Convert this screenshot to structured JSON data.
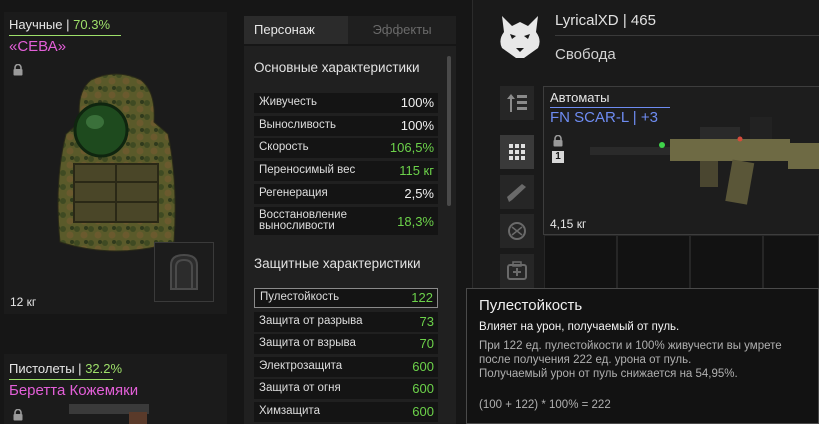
{
  "armor": {
    "category": "Научные",
    "separator": "|",
    "percent": "70.3%",
    "name": "«СЕВА»",
    "weight": "12 кг"
  },
  "pistol": {
    "category": "Пистолеты",
    "separator": "|",
    "percent": "32.2%",
    "name": "Беретта Кожемяки"
  },
  "tabs": {
    "character": "Персонаж",
    "effects": "Эффекты"
  },
  "basic": {
    "title": "Основные характеристики",
    "rows": [
      {
        "label": "Живучесть",
        "value": "100%",
        "tone": "white"
      },
      {
        "label": "Выносливость",
        "value": "100%",
        "tone": "white"
      },
      {
        "label": "Скорость",
        "value": "106,5%",
        "tone": "green"
      },
      {
        "label": "Переносимый вес",
        "value": "115 кг",
        "tone": "green"
      },
      {
        "label": "Регенерация",
        "value": "2,5%",
        "tone": "white"
      },
      {
        "label": "Восстановление выносливости",
        "value": "18,3%",
        "tone": "green"
      }
    ]
  },
  "protect": {
    "title": "Защитные характеристики",
    "rows": [
      {
        "label": "Пулестойкость",
        "value": "122",
        "tone": "green"
      },
      {
        "label": "Защита от разрыва",
        "value": "73",
        "tone": "green"
      },
      {
        "label": "Защита от взрыва",
        "value": "70",
        "tone": "green"
      },
      {
        "label": "Электрозащита",
        "value": "600",
        "tone": "green"
      },
      {
        "label": "Защита от огня",
        "value": "600",
        "tone": "green"
      },
      {
        "label": "Химзащита",
        "value": "600",
        "tone": "green"
      }
    ]
  },
  "player": {
    "name": "LyricalXD",
    "separator": "|",
    "level": "465",
    "faction": "Свобода"
  },
  "weapon": {
    "category": "Автоматы",
    "name": "FN SCAR-L",
    "separator": "|",
    "upgrade": "+3",
    "slot_number": "1",
    "weight": "4,15 кг"
  },
  "tooltip": {
    "title": "Пулестойкость",
    "subtitle": "Влияет на урон, получаемый от пуль.",
    "line1": "При 122 ед. пулестойкости и 100% живучести вы умрете",
    "line2": "после получения 222 ед. урона от пуль.",
    "line3": "Получаемый урон от пуль снижается на 54,95%.",
    "formula": "(100 + 122) * 100% = 222"
  },
  "colors": {
    "accent_green": "#9ee06a",
    "value_green": "#6cd24a",
    "name_pink": "#e35fd8",
    "weapon_blue": "#6e8cf2"
  }
}
